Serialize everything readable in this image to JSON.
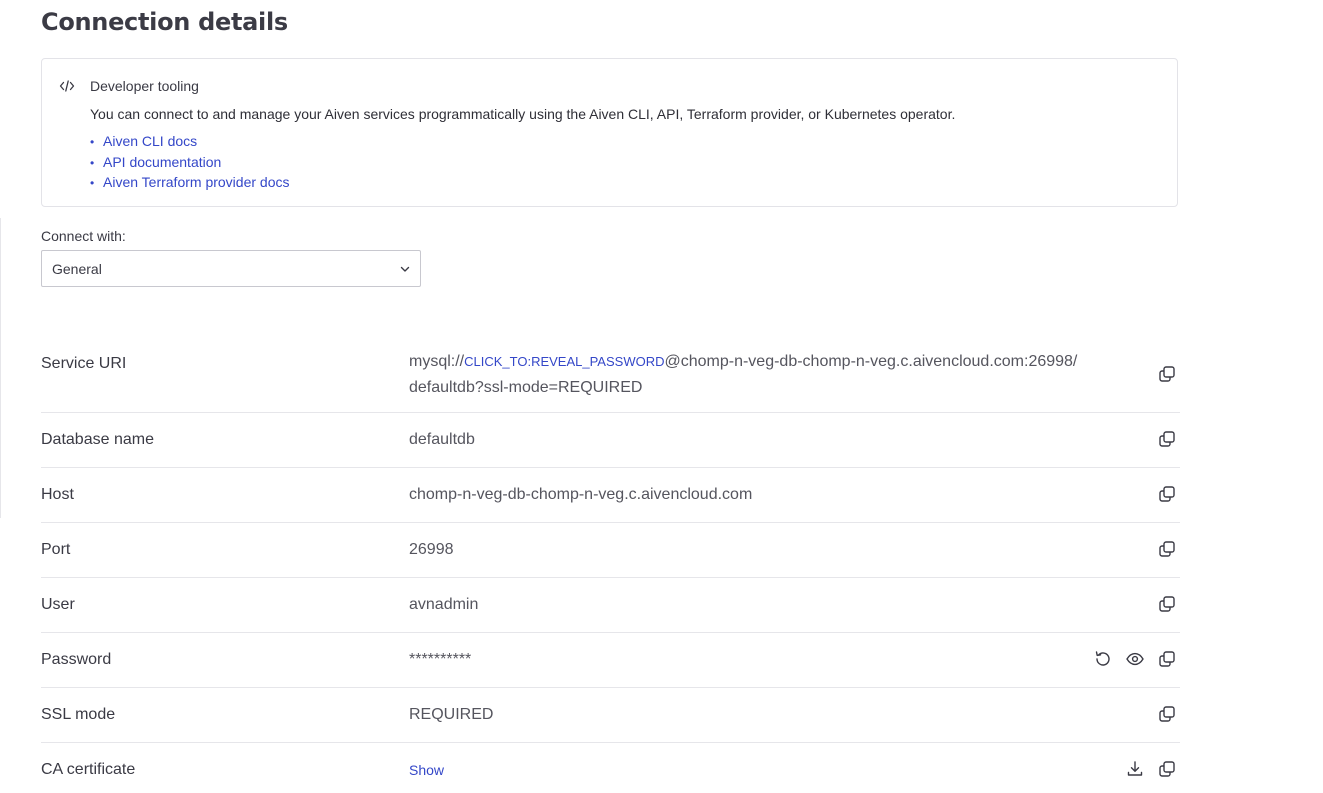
{
  "page": {
    "title": "Connection details"
  },
  "tooling": {
    "title": "Developer tooling",
    "description": "You can connect to and manage your Aiven services programmatically using the Aiven CLI, API, Terraform provider, or Kubernetes operator.",
    "links": [
      "Aiven CLI docs",
      "API documentation",
      "Aiven Terraform provider docs"
    ],
    "icon": "code-icon"
  },
  "connect": {
    "label": "Connect with:",
    "selected": "General"
  },
  "details": {
    "service_uri": {
      "label": "Service URI",
      "prefix": "mysql://",
      "reveal": "CLICK_TO:REVEAL_PASSWORD",
      "suffix": "@chomp-n-veg-db-chomp-n-veg.c.aivencloud.com:26998/",
      "line2": "defaultdb?ssl-mode=REQUIRED"
    },
    "database": {
      "label": "Database name",
      "value": "defaultdb"
    },
    "host": {
      "label": "Host",
      "value": "chomp-n-veg-db-chomp-n-veg.c.aivencloud.com"
    },
    "port": {
      "label": "Port",
      "value": "26998"
    },
    "user": {
      "label": "User",
      "value": "avnadmin"
    },
    "password": {
      "label": "Password",
      "value": "**********"
    },
    "ssl": {
      "label": "SSL mode",
      "value": "REQUIRED"
    },
    "ca": {
      "label": "CA certificate",
      "link": "Show"
    }
  },
  "colors": {
    "link": "#3447c8",
    "text": "#3a3a44",
    "border": "#e6e6ea"
  }
}
